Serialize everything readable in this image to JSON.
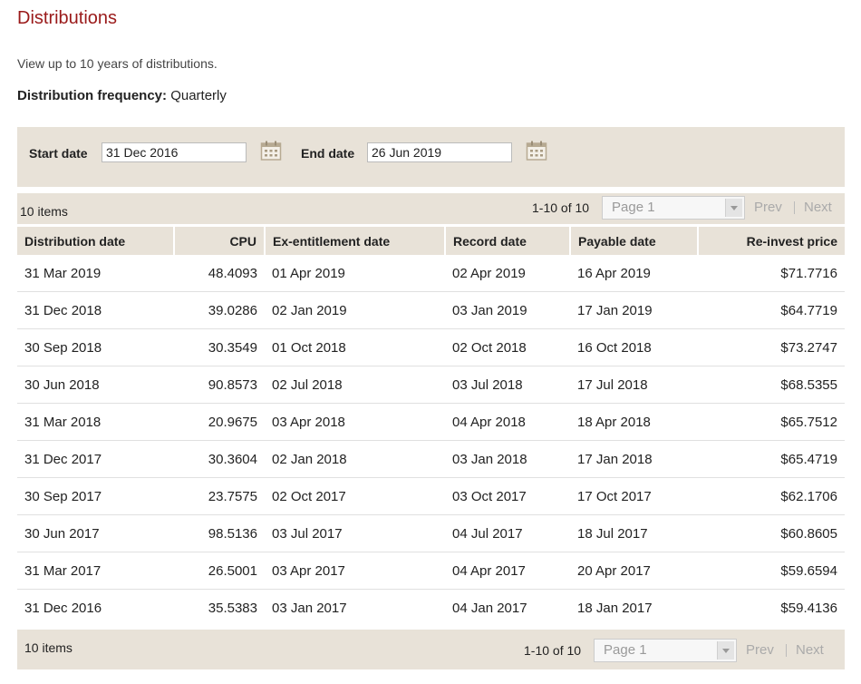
{
  "page": {
    "title": "Distributions",
    "subtitle": "View up to 10 years of distributions.",
    "frequency_label": "Distribution frequency:",
    "frequency_value": "Quarterly"
  },
  "filter": {
    "start_label": "Start date",
    "start_value": "31 Dec 2016",
    "end_label": "End date",
    "end_value": "26 Jun 2019",
    "calendar_icon": "calendar-icon"
  },
  "pager": {
    "items_count": "10 items",
    "range": "1-10 of 10",
    "page_select": "Page 1",
    "prev": "Prev",
    "next": "Next"
  },
  "table": {
    "headers": [
      "Distribution date",
      "CPU",
      "Ex-entitlement date",
      "Record date",
      "Payable date",
      "Re-invest price"
    ],
    "rows": [
      [
        "31 Mar 2019",
        "48.4093",
        "01 Apr 2019",
        "02 Apr 2019",
        "16 Apr 2019",
        "$71.7716"
      ],
      [
        "31 Dec 2018",
        "39.0286",
        "02 Jan 2019",
        "03 Jan 2019",
        "17 Jan 2019",
        "$64.7719"
      ],
      [
        "30 Sep 2018",
        "30.3549",
        "01 Oct 2018",
        "02 Oct 2018",
        "16 Oct 2018",
        "$73.2747"
      ],
      [
        "30 Jun 2018",
        "90.8573",
        "02 Jul 2018",
        "03 Jul 2018",
        "17 Jul 2018",
        "$68.5355"
      ],
      [
        "31 Mar 2018",
        "20.9675",
        "03 Apr 2018",
        "04 Apr 2018",
        "18 Apr 2018",
        "$65.7512"
      ],
      [
        "31 Dec 2017",
        "30.3604",
        "02 Jan 2018",
        "03 Jan 2018",
        "17 Jan 2018",
        "$65.4719"
      ],
      [
        "30 Sep 2017",
        "23.7575",
        "02 Oct 2017",
        "03 Oct 2017",
        "17 Oct 2017",
        "$62.1706"
      ],
      [
        "30 Jun 2017",
        "98.5136",
        "03 Jul 2017",
        "04 Jul 2017",
        "18 Jul 2017",
        "$60.8605"
      ],
      [
        "31 Mar 2017",
        "26.5001",
        "03 Apr 2017",
        "04 Apr 2017",
        "20 Apr 2017",
        "$59.6594"
      ],
      [
        "31 Dec 2016",
        "35.5383",
        "03 Jan 2017",
        "04 Jan 2017",
        "18 Jan 2017",
        "$59.4136"
      ]
    ]
  },
  "colors": {
    "title": "#9a1a1a",
    "panel": "#e8e2d8",
    "disabled_text": "#aaaaaa"
  }
}
